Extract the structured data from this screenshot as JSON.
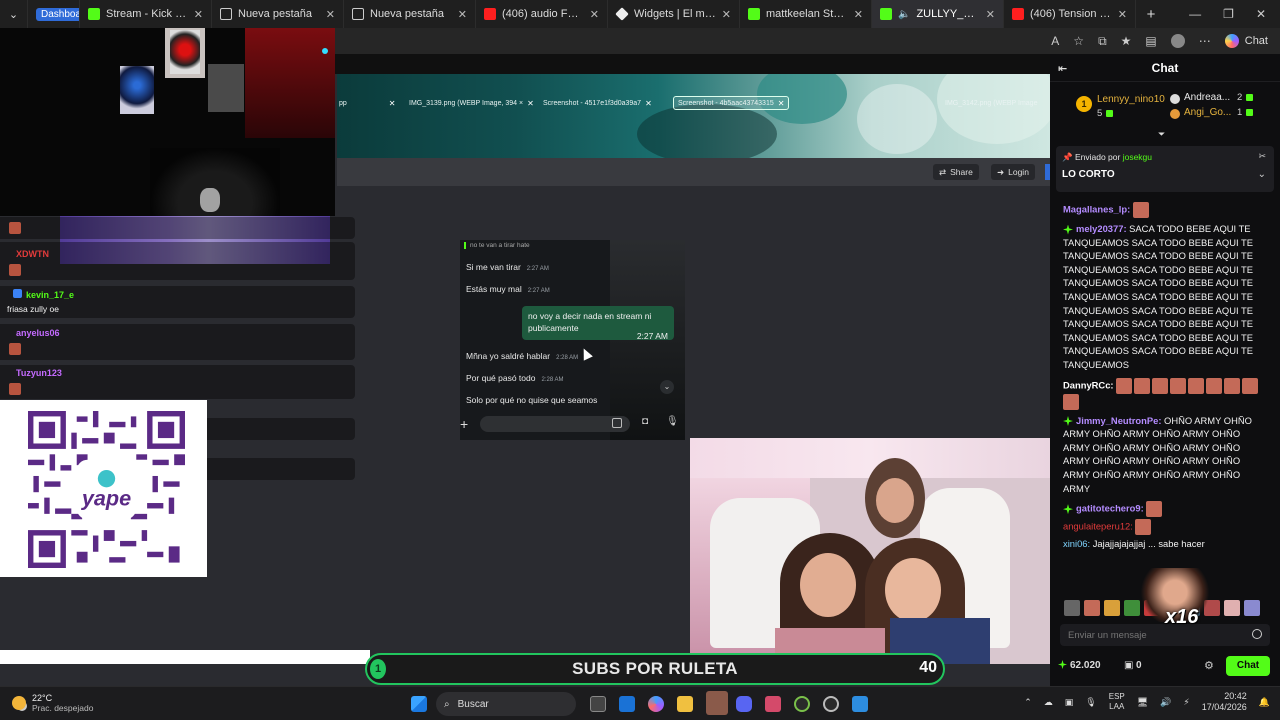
{
  "browser": {
    "tabs": [
      {
        "label": "Dashboard",
        "badge": true
      },
      {
        "label": "Stream - Kick Dashboard"
      },
      {
        "label": "Nueva pestaña"
      },
      {
        "label": "Nueva pestaña"
      },
      {
        "label": "(406) audio FUEGO, FUEGO"
      },
      {
        "label": "Widgets | El mejor software"
      },
      {
        "label": "mattkeelan Stream - Watch"
      },
      {
        "label": "ZULLYY_CS Stream - W"
      },
      {
        "label": "(406) Tension Suspense C"
      }
    ],
    "chat_button": "Chat"
  },
  "overlay_chat": [
    {
      "user": "XDWTN",
      "color": "#e23b3b",
      "text": ""
    },
    {
      "user": "kevin_17_e",
      "color": "#53fc18",
      "text": "friasa zully oe"
    },
    {
      "user": "anyelus06",
      "color": "#c46bff",
      "text": ""
    },
    {
      "user": "Tuzyun123",
      "color": "#c46bff",
      "text": ""
    }
  ],
  "screenshot_in_stream": {
    "tabs": [
      "IMG_3139.png (WEBP Image, 394 ×",
      "Screenshot - 4517e1f3d0a39a7",
      "Screenshot - 4b5aac43743315",
      "IMG_3142.png (WEBP Image"
    ],
    "share": "Share",
    "login": "Login"
  },
  "phone_chat": {
    "top": "no te van a tirar hate",
    "messages": [
      {
        "text": "Si me van tirar",
        "time": "2:27 AM"
      },
      {
        "text": "Estás muy mal",
        "time": "2:27 AM"
      },
      {
        "text": "Mñna yo saldré hablar",
        "time": "2:28 AM"
      },
      {
        "text": "Por qué pasó todo",
        "time": "2:28 AM"
      },
      {
        "text": "Solo por qué no quise que seamos",
        "time": ""
      }
    ],
    "mine": {
      "text": "no voy a decir nada en stream ni publicamente",
      "time": "2:27 AM"
    }
  },
  "subs_bar": {
    "label": "SUBS POR RULETA",
    "count": "40",
    "start": "1"
  },
  "chat": {
    "title": "Chat",
    "leaders": [
      {
        "rank": "1",
        "name": "Lennyy_nino10",
        "count": "5"
      },
      {
        "name": "Andreaa...",
        "count": "2"
      },
      {
        "name": "Angi_Go...",
        "count": "1"
      }
    ],
    "pinned": {
      "by_label": "Enviado por",
      "by": "josekgu",
      "message": "LO CORTO"
    },
    "messages": [
      {
        "user": "Magallanes_lp:",
        "color": "#b48cff",
        "text": ""
      },
      {
        "user": "mely20377:",
        "color": "#b48cff",
        "badge": true,
        "text": " SACA TODO BEBE AQUI TE TANQUEAMOS SACA TODO BEBE AQUI TE TANQUEAMOS SACA TODO BEBE AQUI TE TANQUEAMOS SACA TODO BEBE AQUI TE TANQUEAMOS SACA TODO BEBE AQUI TE TANQUEAMOS SACA TODO BEBE AQUI TE TANQUEAMOS SACA TODO BEBE AQUI TE TANQUEAMOS SACA TODO BEBE AQUI TE TANQUEAMOS SACA TODO BEBE AQUI TE TANQUEAMOS SACA TODO BEBE AQUI TE TANQUEAMOS"
      },
      {
        "user": "DannyRCc:",
        "color": "#ffffff",
        "text": ""
      },
      {
        "user": "Jimmy_NeutronPe:",
        "color": "#b48cff",
        "badge": true,
        "text": " OHÑO ARMY OHÑO ARMY OHÑO ARMY OHÑO ARMY OHÑO ARMY OHÑO ARMY OHÑO ARMY OHÑO ARMY OHÑO ARMY OHÑO ARMY OHÑO ARMY OHÑO ARMY OHÑO ARMY OHÑO ARMY"
      },
      {
        "user": "gatitotechero9:",
        "color": "#b48cff",
        "badge": true,
        "text": ""
      },
      {
        "user": "angulaiteperu12:",
        "color": "#e23b3b",
        "text": ""
      },
      {
        "user": "xini06:",
        "color": "#7fd4ff",
        "text": " Jajajjajajajjaj ... sabe hacer"
      }
    ],
    "input_placeholder": "Enviar un mensaje",
    "points": "62.020",
    "count": "0",
    "send": "Chat",
    "multiplier": "x16"
  },
  "taskbar": {
    "temp": "22°C",
    "weather": "Prac. despejado",
    "search": "Buscar",
    "lang1": "ESP",
    "lang2": "LAA",
    "time": "20:42",
    "date": "17/04/2026"
  }
}
